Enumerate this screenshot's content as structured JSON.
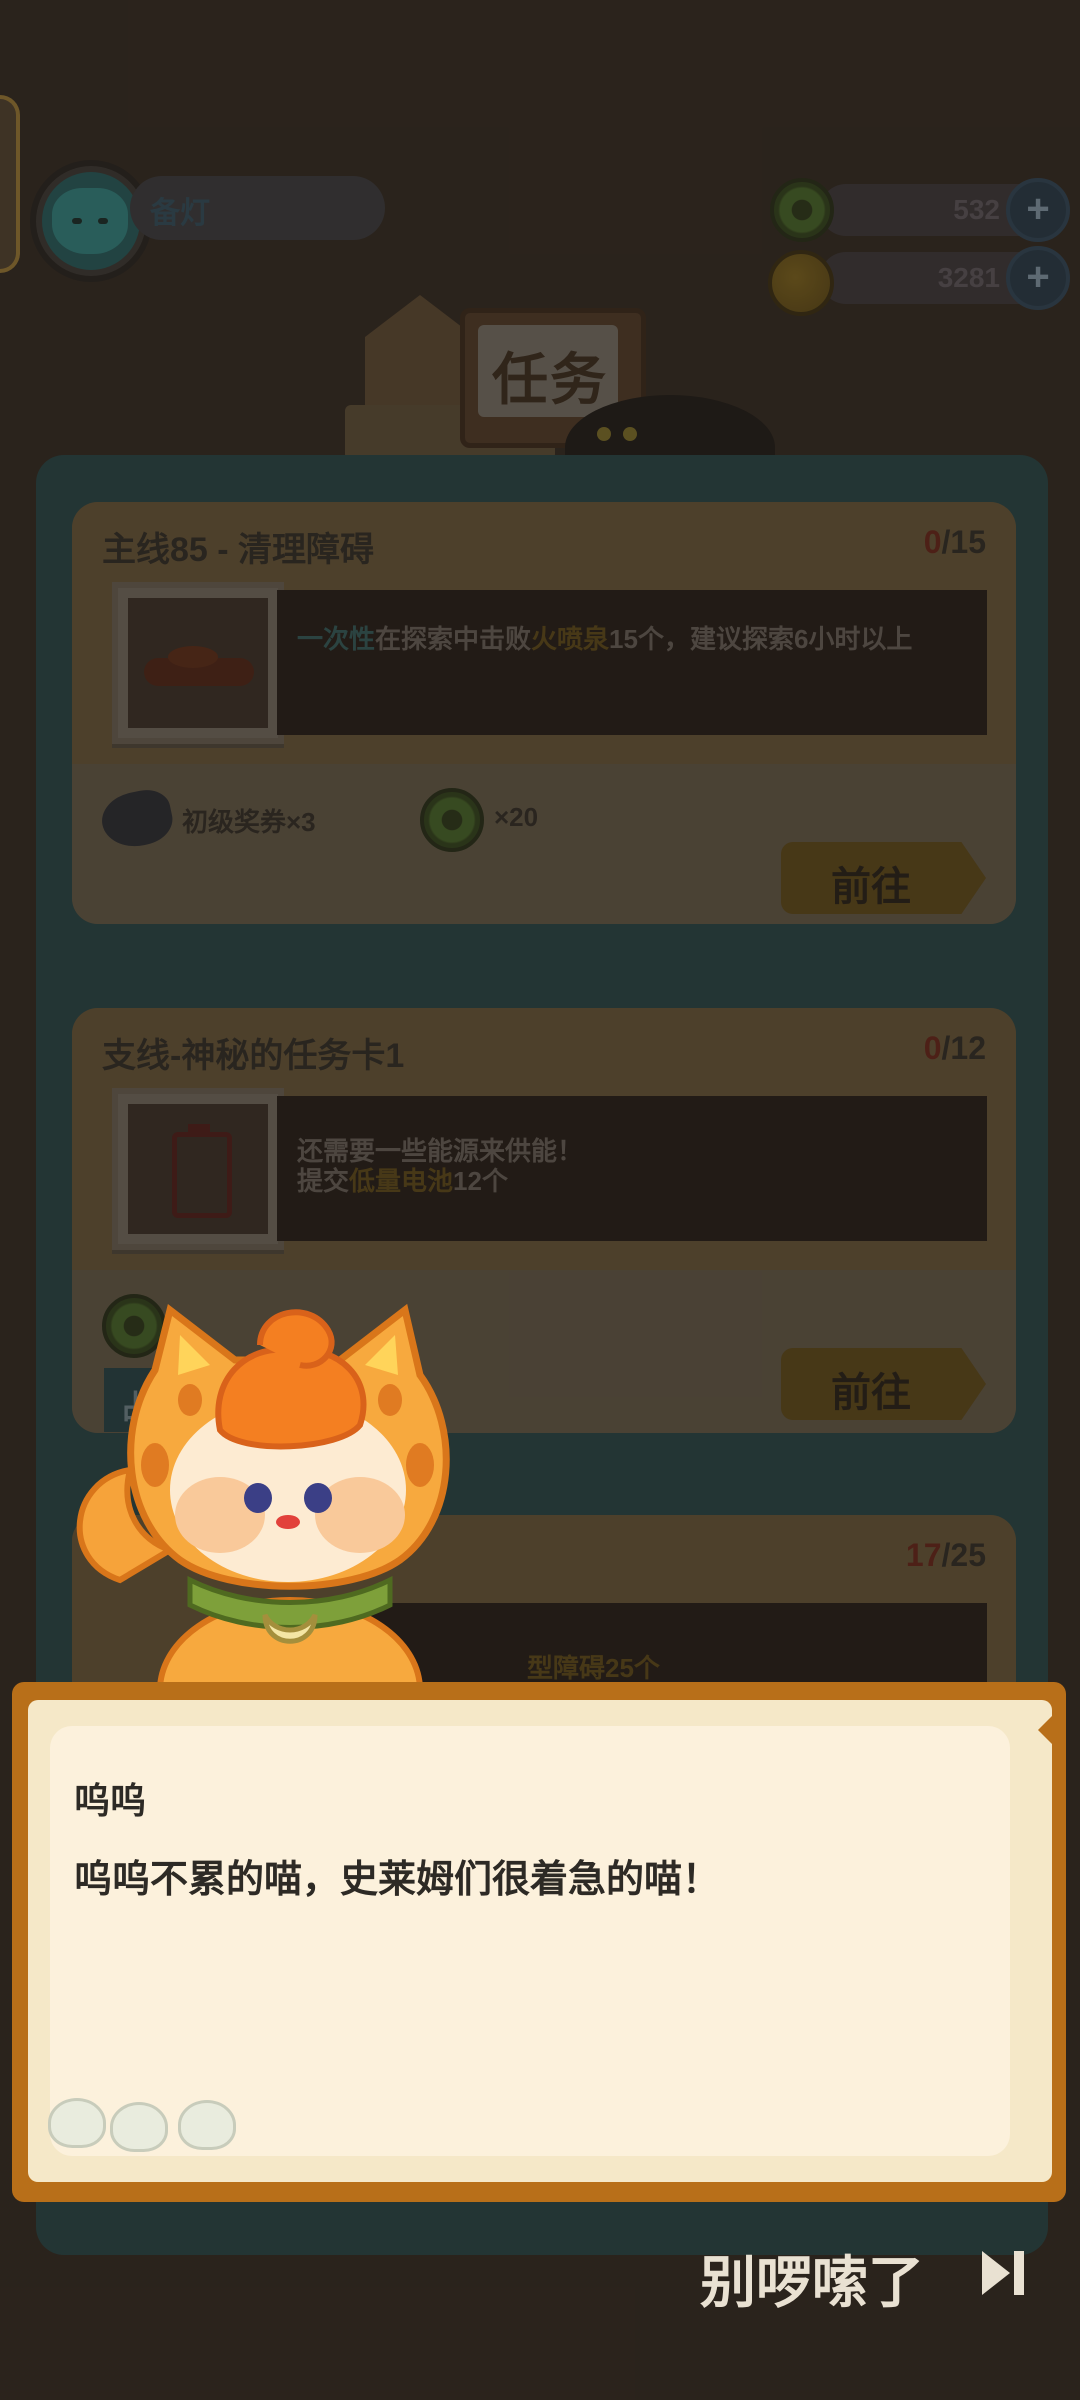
{
  "player": {
    "name": "备灯"
  },
  "resources": [
    {
      "name": "green-gear-coin",
      "value": "532"
    },
    {
      "name": "gold-coin",
      "value": "3281"
    }
  ],
  "screen": {
    "title": "任务"
  },
  "tasks": [
    {
      "title": "主线85 - 清理障碍",
      "progress_current": "0",
      "progress_total": "/15",
      "desc_pre": "",
      "desc_hl1": "一次性",
      "desc_mid": "在探索中击败",
      "desc_hl2": "火喷泉",
      "desc_post": "15个，建议探索6小时以上",
      "rewards": [
        {
          "icon": "ticket-icon",
          "label": "初级奖券×3"
        },
        {
          "icon": "green-gear-coin-icon",
          "label": "×20"
        }
      ],
      "button": "前往"
    },
    {
      "title": "支线-神秘的任务卡1",
      "progress_current": "0",
      "progress_total": "/12",
      "desc_line1": "还需要一些能源来供能！",
      "desc_pre2": "提交",
      "desc_hl": "低量电池",
      "desc_post2": "12个",
      "button": "前往",
      "left_partial": "占"
    },
    {
      "progress_current": "17",
      "progress_total": "/25",
      "desc_partial": "型障碍25个"
    }
  ],
  "dialog": {
    "speaker": "呜呜",
    "text": "呜呜不累的喵，史莱姆们很着急的喵！"
  },
  "skip": {
    "label": "别啰嗦了"
  },
  "colors": {
    "dialog_frame": "#e88a1a",
    "dialog_paper": "#fdf2dd",
    "panel": "#2b7b86",
    "button": "#e2b326"
  }
}
